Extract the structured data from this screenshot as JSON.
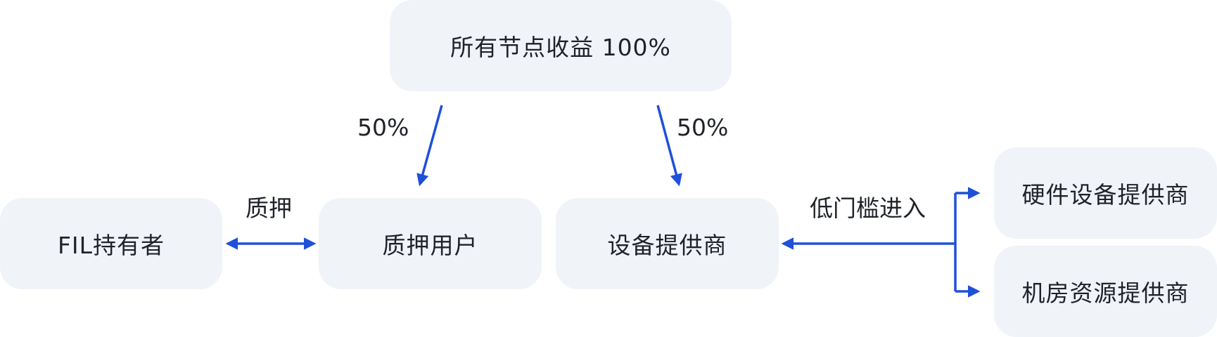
{
  "diagram": {
    "nodes": {
      "total_revenue": "所有节点收益 100%",
      "fil_holder": "FIL持有者",
      "pledge_user": "质押用户",
      "equipment_provider": "设备提供商",
      "hardware_provider": "硬件设备提供商",
      "datacenter_provider": "机房资源提供商"
    },
    "edge_labels": {
      "to_pledge_user_share": "50%",
      "to_equipment_provider_share": "50%",
      "pledge": "质押",
      "low_barrier_entry": "低门槛进入"
    },
    "colors": {
      "node_fill": "#f0f3f8",
      "arrow": "#1f50d8",
      "text": "#1f2329"
    }
  }
}
